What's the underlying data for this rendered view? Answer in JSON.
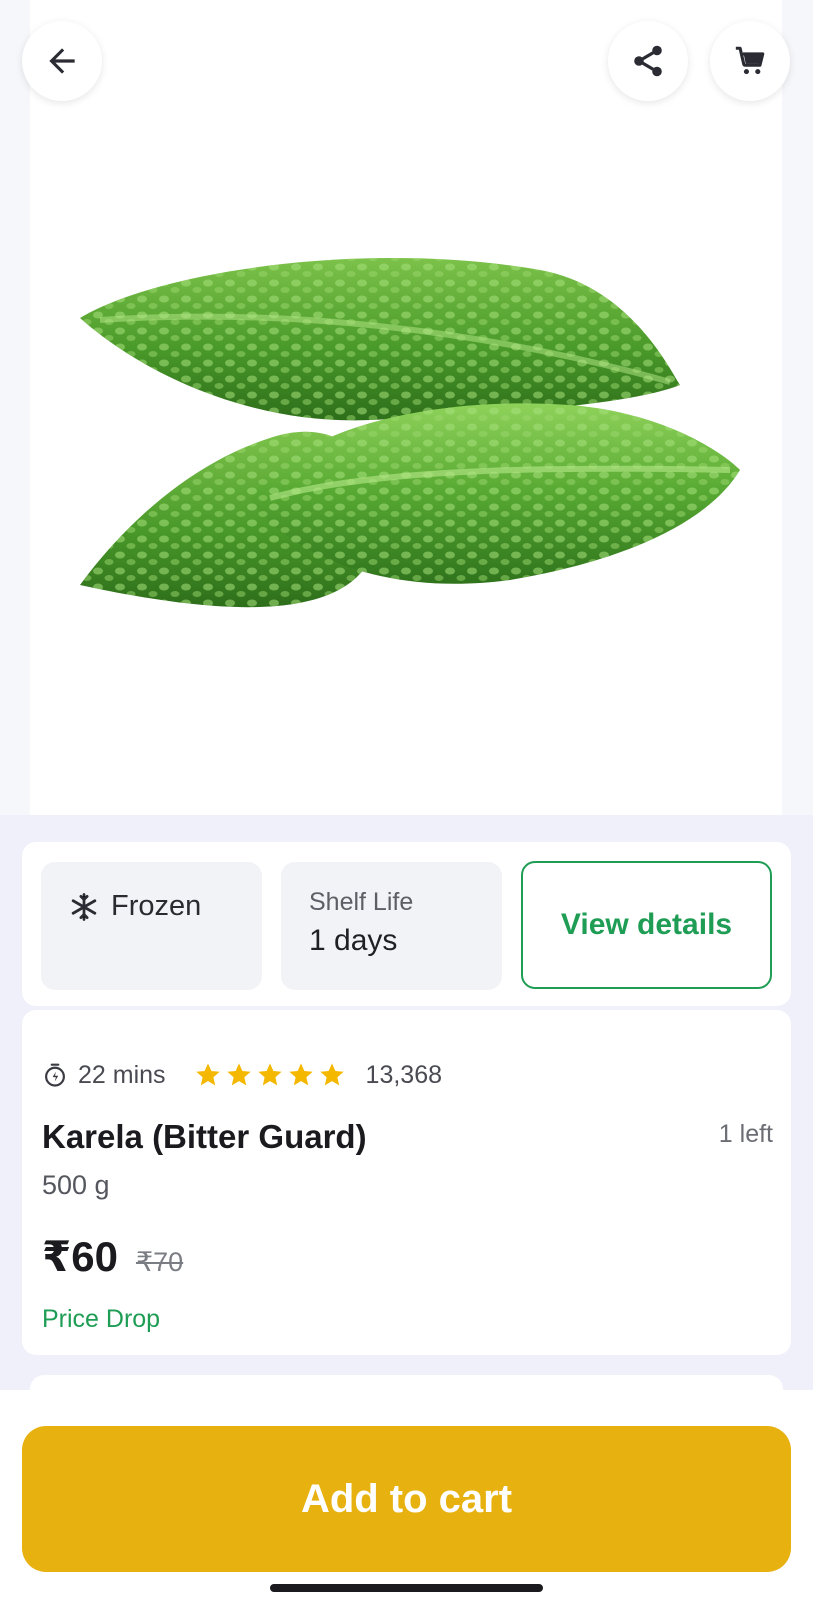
{
  "header": {
    "back_icon": "arrow-left-icon",
    "share_icon": "share-icon",
    "cart_icon": "cart-icon"
  },
  "product_image": {
    "alt": "Karela (Bitter Guard)"
  },
  "info": {
    "storage": {
      "icon": "snowflake-icon",
      "label": "Frozen"
    },
    "shelf_life": {
      "title": "Shelf Life",
      "value": "1 days"
    },
    "view_details_label": "View details"
  },
  "product": {
    "delivery_time": "22 mins",
    "rating_stars": 5,
    "rating_count": "13,368",
    "name": "Karela (Bitter Guard)",
    "stock": "1 left",
    "weight": "500 g",
    "price": "₹60",
    "mrp": "₹70",
    "badge": "Price Drop"
  },
  "cta": {
    "label": "Add to cart"
  },
  "colors": {
    "accent_green": "#1f9d55",
    "cta_yellow": "#e7b10f",
    "star": "#f5b800"
  }
}
